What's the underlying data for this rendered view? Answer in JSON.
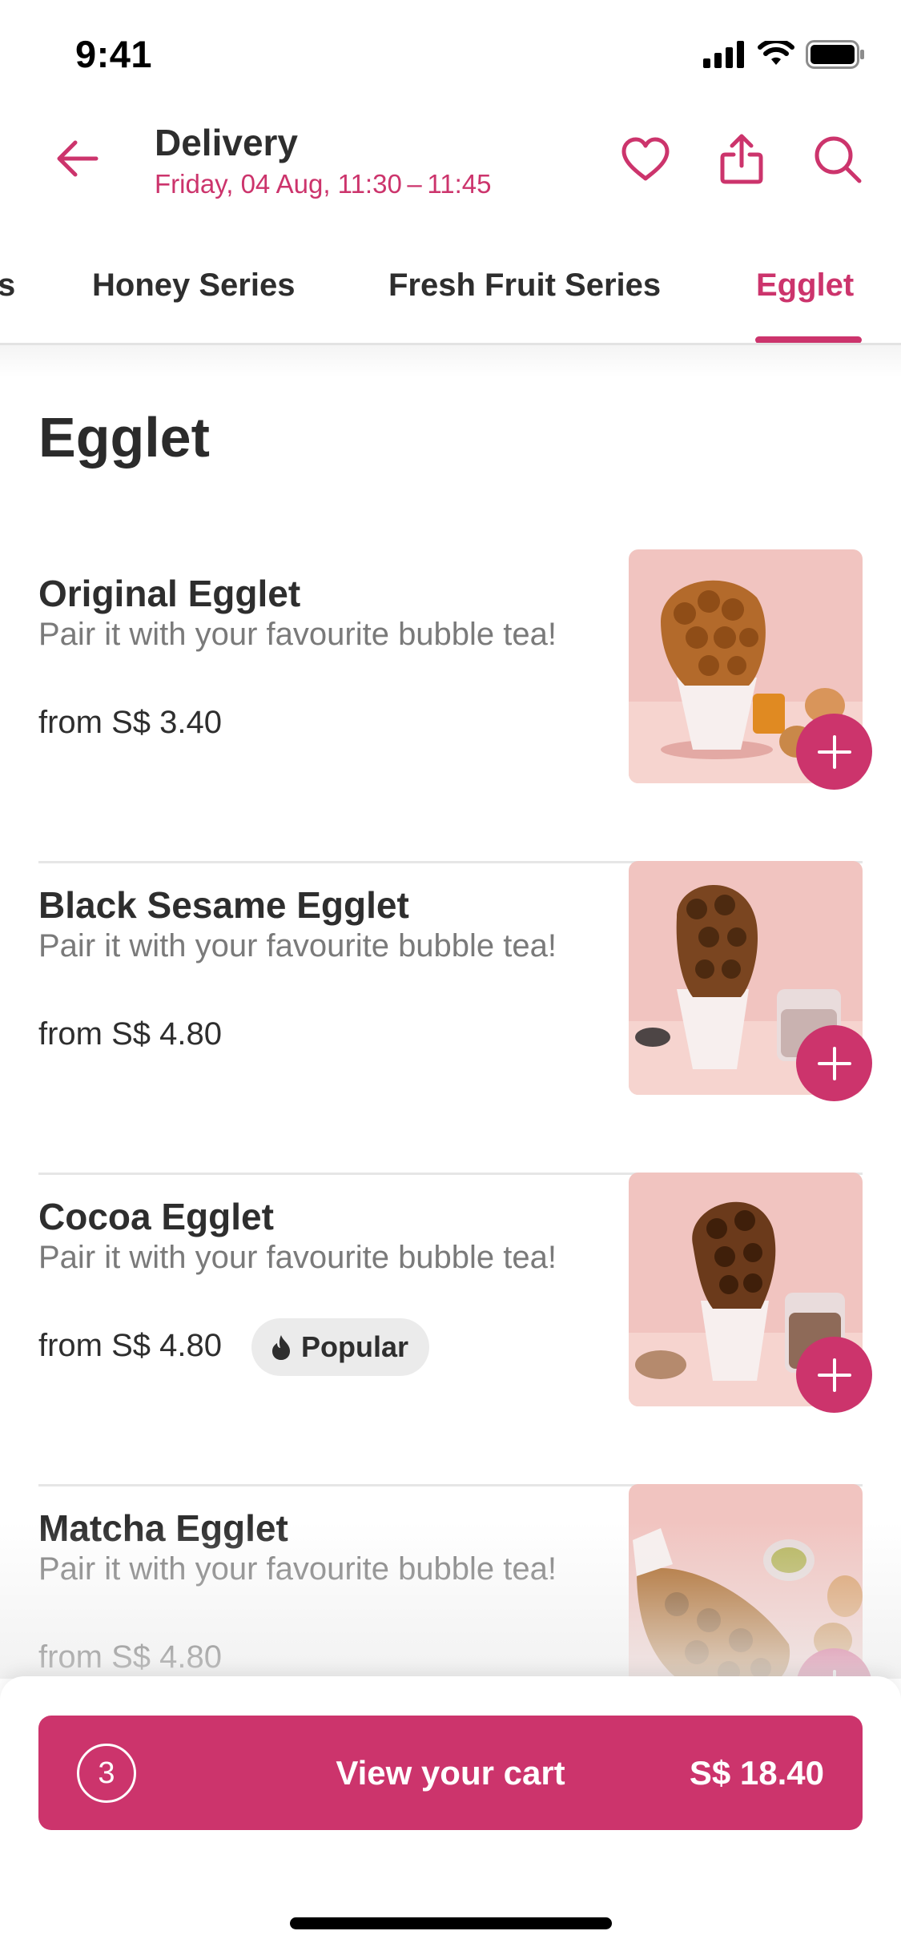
{
  "status_bar": {
    "time": "9:41"
  },
  "header": {
    "title": "Delivery",
    "subtitle": "Friday, 04 Aug, 11:30 – 11:45",
    "actions": [
      "heart-icon",
      "share-icon",
      "search-icon"
    ]
  },
  "tabs": [
    {
      "label": "s",
      "active": false
    },
    {
      "label": "Honey Series",
      "active": false
    },
    {
      "label": "Fresh Fruit Series",
      "active": false
    },
    {
      "label": "Egglet",
      "active": true
    }
  ],
  "section": {
    "title": "Egglet",
    "items": [
      {
        "name": "Original Egglet",
        "description": "Pair it with your favourite bubble tea!",
        "price": "from S$ 3.40"
      },
      {
        "name": "Black Sesame Egglet",
        "description": "Pair it with your favourite bubble tea!",
        "price": "from S$ 4.80"
      },
      {
        "name": "Cocoa Egglet",
        "description": "Pair it with your favourite bubble tea!",
        "price": "from S$ 4.80",
        "badge": "Popular"
      },
      {
        "name": "Matcha Egglet",
        "description": "Pair it with your favourite bubble tea!",
        "price": "from S$ 4.80"
      }
    ]
  },
  "cart": {
    "count": "3",
    "label": "View your cart",
    "total": "S$ 18.40"
  },
  "colors": {
    "accent": "#cc346c",
    "text": "#2e2e2e",
    "muted": "#7a7a7a",
    "badge_bg": "#ebebeb"
  }
}
